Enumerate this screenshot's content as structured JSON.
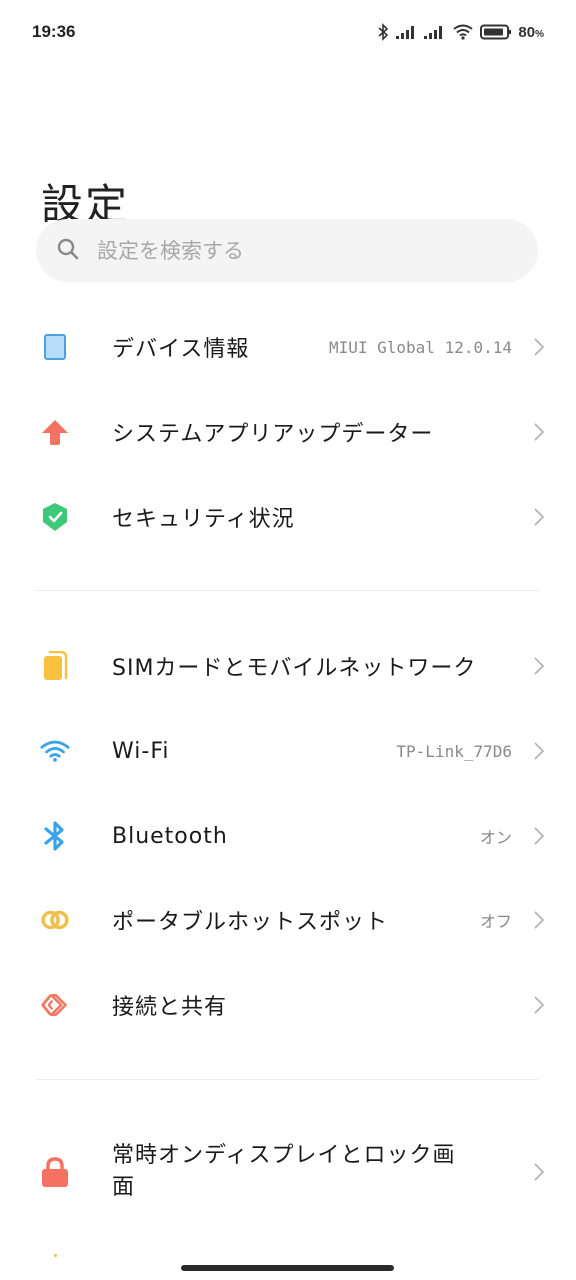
{
  "status_bar": {
    "time": "19:36",
    "icons": [
      "bluetooth-icon",
      "signal-icon",
      "signal-icon",
      "wifi-icon",
      "battery-icon"
    ],
    "battery_percent": "80",
    "battery_percent_sign": "%"
  },
  "header": {
    "title": "設定"
  },
  "search": {
    "placeholder": "設定を検索する",
    "value": "",
    "icon": "search-icon"
  },
  "sections": [
    {
      "items": [
        {
          "label": "デバイス情報",
          "value": "MIUI Global 12.0.14",
          "icon": "device-icon",
          "icon_color": "#4aa3e0"
        },
        {
          "label": "システムアプリアップデーター",
          "value": "",
          "icon": "arrow-up-icon",
          "icon_color": "#f47260"
        },
        {
          "label": "セキュリティ状況",
          "value": "",
          "icon": "shield-check-icon",
          "icon_color": "#3ec97a"
        }
      ]
    },
    {
      "items": [
        {
          "label": "SIMカードとモバイルネットワーク",
          "value": "",
          "icon": "sim-card-icon",
          "icon_color": "#f8c140"
        },
        {
          "label": "Wi-Fi",
          "value": "TP-Link_77D6",
          "icon": "wifi-icon",
          "icon_color": "#3ba4e8"
        },
        {
          "label": "Bluetooth",
          "value": "オン",
          "icon": "bluetooth-icon",
          "icon_color": "#3ba4e8"
        },
        {
          "label": "ポータブルホットスポット",
          "value": "オフ",
          "icon": "hotspot-link-icon",
          "icon_color": "#efc050"
        },
        {
          "label": "接続と共有",
          "value": "",
          "icon": "connection-share-icon",
          "icon_color": "#ee7a66"
        }
      ]
    },
    {
      "items": [
        {
          "label": "常時オンディスプレイとロック画面",
          "value": "",
          "icon": "lock-icon",
          "icon_color": "#f47260"
        }
      ]
    }
  ]
}
